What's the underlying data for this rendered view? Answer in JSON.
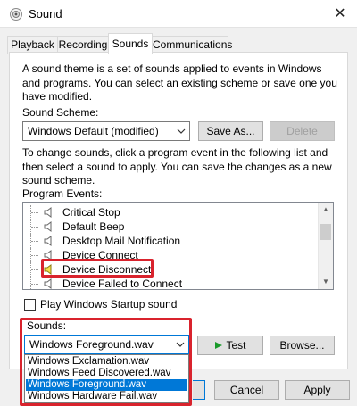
{
  "window": {
    "title": "Sound"
  },
  "tabs": [
    {
      "label": "Playback"
    },
    {
      "label": "Recording"
    },
    {
      "label": "Sounds"
    },
    {
      "label": "Communications"
    }
  ],
  "intro_text": "A sound theme is a set of sounds applied to events in Windows and programs.  You can select an existing scheme or save one you have modified.",
  "scheme": {
    "label": "Sound Scheme:",
    "label_accel": "h",
    "value": "Windows Default (modified)",
    "save_as_label": "Save As...",
    "delete_label": "Delete"
  },
  "change_text": "To change sounds, click a program event in the following list and then select a sound to apply.  You can save the changes as a new sound scheme.",
  "events": {
    "label": "Program Events:",
    "items": [
      {
        "label": "Critical Stop"
      },
      {
        "label": "Default Beep"
      },
      {
        "label": "Desktop Mail Notification"
      },
      {
        "label": "Device Connect"
      },
      {
        "label": "Device Disconnect"
      },
      {
        "label": "Device Failed to Connect"
      }
    ]
  },
  "startup_checkbox": {
    "label": "Play Windows Startup sound",
    "checked": false
  },
  "sounds": {
    "label": "Sounds:",
    "value": "Windows Foreground.wav",
    "options": [
      "Windows Exclamation.wav",
      "Windows Feed Discovered.wav",
      "Windows Foreground.wav",
      "Windows Hardware Fail.wav"
    ],
    "test_label": "Test",
    "browse_label": "Browse..."
  },
  "footer": {
    "cancel_label": "Cancel",
    "apply_label": "Apply"
  },
  "colors": {
    "highlight": "#d9232d",
    "selection": "#0078d7"
  }
}
